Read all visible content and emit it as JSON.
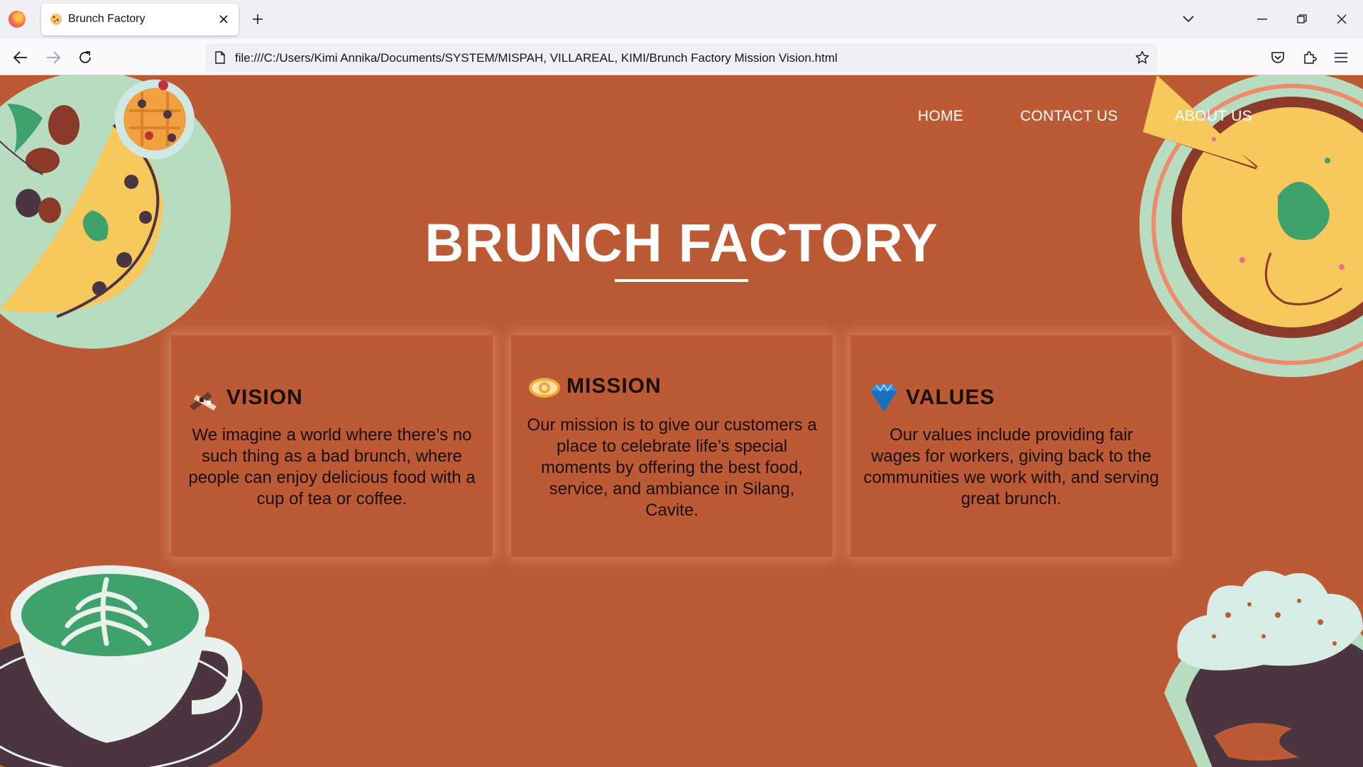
{
  "browser": {
    "tab_title": "Brunch Factory",
    "url": "file:///C:/Users/Kimi Annika/Documents/SYSTEM/MISPAH, VILLAREAL, KIMI/Brunch Factory Mission Vision.html"
  },
  "site": {
    "nav": [
      "HOME",
      "CONTACT US",
      "ABOUT US"
    ],
    "title": "BRUNCH FACTORY",
    "cards": [
      {
        "icon": "heart-hands-icon",
        "title": "VISION",
        "text": "We imagine a world where there’s no such thing as a bad brunch, where people can enjoy delicious food with a cup of tea or coffee."
      },
      {
        "icon": "eye-icon",
        "title": "MISSION",
        "text": "Our mission is to give our customers a place to celebrate life’s special moments by offering the best food, service, and ambiance in Silang, Cavite."
      },
      {
        "icon": "diamond-icon",
        "title": "VALUES",
        "text": "Our values include providing fair wages for workers, giving back to the communities we work with, and serving great brunch."
      }
    ]
  },
  "colors": {
    "page_background": "#bc5a36",
    "plate_green": "#b8dcc0",
    "omelette_yellow": "#f7c85c",
    "coffee_green": "#3fa26d",
    "mug_dark": "#4a3540"
  }
}
